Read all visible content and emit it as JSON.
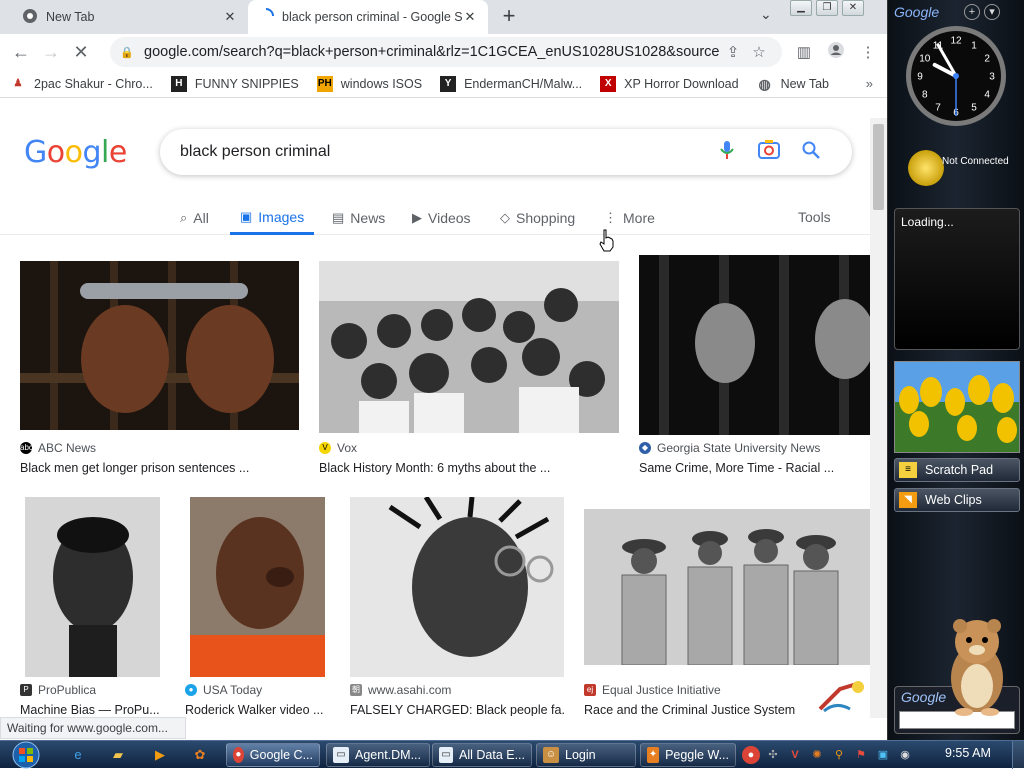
{
  "browser": {
    "tabs": [
      {
        "title": "New Tab",
        "icon": "chrome-icon",
        "active": false
      },
      {
        "title": "black person criminal - Google Search",
        "icon": "loading-spinner-icon",
        "active": true
      }
    ],
    "url": "google.com/search?q=black+person+criminal&rlz=1C1GCEA_enUS1028US1028&source=...",
    "bookmarks": [
      {
        "label": "2pac Shakur - Chro...",
        "icon": "page-icon",
        "color": "#c0392b"
      },
      {
        "label": "FUNNY SNIPPIES",
        "icon": "h-icon",
        "color": "#222222"
      },
      {
        "label": "windows ISOS",
        "icon": "ph-icon",
        "color": "#f0a500"
      },
      {
        "label": "EndermanCH/Malw...",
        "icon": "y-icon",
        "color": "#222222"
      },
      {
        "label": "XP Horror Download",
        "icon": "x-icon",
        "color": "#c00000"
      },
      {
        "label": "New Tab",
        "icon": "globe-icon",
        "color": "#5f6368"
      }
    ],
    "status": "Waiting for www.google.com..."
  },
  "google": {
    "logo": "Google",
    "query": "black person criminal",
    "tabs": [
      {
        "label": "All",
        "icon": "search-icon",
        "active": false
      },
      {
        "label": "Images",
        "icon": "image-icon",
        "active": true
      },
      {
        "label": "News",
        "icon": "news-icon",
        "active": false
      },
      {
        "label": "Videos",
        "icon": "video-icon",
        "active": false
      },
      {
        "label": "Shopping",
        "icon": "tag-icon",
        "active": false
      },
      {
        "label": "More",
        "icon": "more-vert-icon",
        "active": false
      }
    ],
    "tools": "Tools",
    "results": [
      {
        "source": "ABC News",
        "title": "Black men get longer prison sentences ...",
        "favcolor": "#000000"
      },
      {
        "source": "Vox",
        "title": "Black History Month: 6 myths about the ...",
        "favcolor": "#f5d600"
      },
      {
        "source": "Georgia State University News",
        "title": "Same Crime, More Time - Racial ...",
        "favcolor": "#2f5fa8"
      },
      {
        "source": "ProPublica",
        "title": "Machine Bias — ProPu...",
        "favcolor": "#333333"
      },
      {
        "source": "USA Today",
        "title": "Roderick Walker video ...",
        "favcolor": "#1aa3e8"
      },
      {
        "source": "www.asahi.com",
        "title": "FALSELY CHARGED: Black people fa...",
        "favcolor": "#888888"
      },
      {
        "source": "Equal Justice Initiative",
        "title": "Race and the Criminal Justice System",
        "favcolor": "#c0392b"
      }
    ]
  },
  "gadgets": {
    "title": "Google",
    "clock": {
      "hour": 9,
      "minute": 55
    },
    "clock_label": "12",
    "weather": "Not Connected",
    "feed": "Loading...",
    "scratch_pad": "Scratch Pad",
    "web_clips": "Web Clips",
    "search_label": "Google"
  },
  "taskbar": {
    "items": [
      {
        "label": "Google C...",
        "icon": "chrome-icon",
        "color": "#db4437",
        "active": true
      },
      {
        "label": "Agent.DM...",
        "icon": "window-icon",
        "color": "#ffffff",
        "active": false
      },
      {
        "label": "All Data E...",
        "icon": "window-icon",
        "color": "#ffffff",
        "active": false
      },
      {
        "label": "Login",
        "icon": "user-icon",
        "color": "#c98f42",
        "active": false
      },
      {
        "label": "Peggle W...",
        "icon": "peggle-icon",
        "color": "#e67e22",
        "active": false
      }
    ],
    "time": "9:55 AM"
  }
}
